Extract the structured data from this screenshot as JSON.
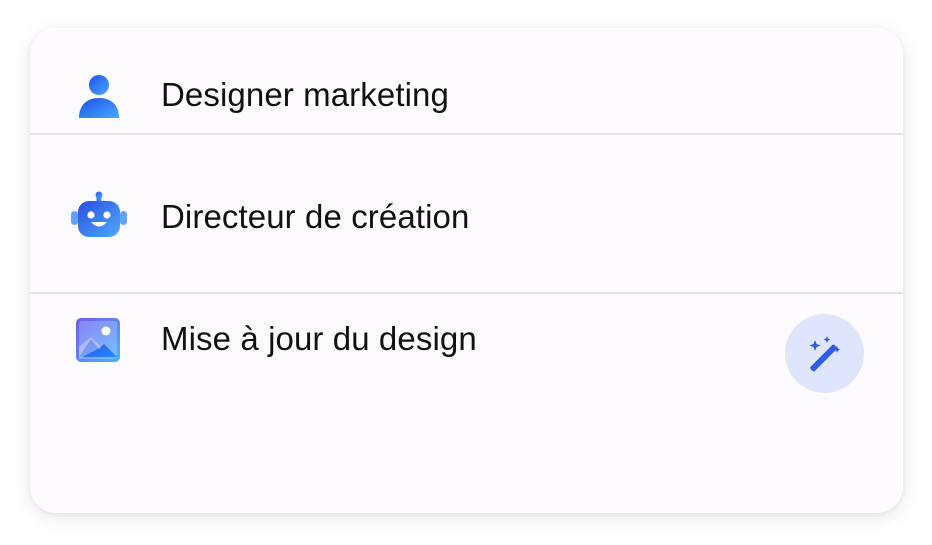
{
  "items": [
    {
      "label": "Designer marketing",
      "icon": "user-icon"
    },
    {
      "label": "Directeur de création",
      "icon": "robot-icon"
    },
    {
      "label": "Mise à jour du design",
      "icon": "image-icon"
    }
  ],
  "action": {
    "icon": "magic-wand-icon"
  },
  "colors": {
    "accent": "#2f5be6",
    "accent_light": "#dfe6fb",
    "gradient_start": "#1c5cf0",
    "gradient_end": "#5fb8ff",
    "card_background": "#fdfbfd",
    "divider": "#e4e4e8"
  }
}
